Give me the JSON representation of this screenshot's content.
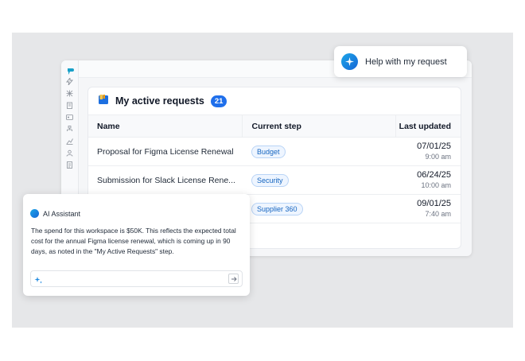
{
  "colors": {
    "accent": "#1f6feb",
    "pill_bg": "#eef5ff",
    "pill_text": "#1565c0",
    "backdrop": "#e6e7e9"
  },
  "sidebar": {
    "icons": [
      "app-logo-icon",
      "lightning-icon",
      "grid-icon",
      "building-icon",
      "id-card-icon",
      "hierarchy-icon",
      "chart-icon",
      "user-icon",
      "document-icon"
    ]
  },
  "help": {
    "label": "Help with my request",
    "icon": "sparkle-icon"
  },
  "requests": {
    "title": "My active requests",
    "count": "21",
    "columns": {
      "name": "Name",
      "step": "Current step",
      "updated": "Last updated"
    },
    "rows": [
      {
        "name": "Proposal for Figma License Renewal",
        "step": "Budget",
        "date": "07/01/25",
        "time": "9:00 am"
      },
      {
        "name": "Submission for Slack License Rene...",
        "step": "Security",
        "date": "06/24/25",
        "time": "10:00 am"
      },
      {
        "name": "",
        "step": "Supplier 360",
        "date": "09/01/25",
        "time": "7:40 am"
      }
    ]
  },
  "assistant": {
    "title": "AI Assistant",
    "message": "The spend for this workspace is $50K. This reflects the expected total cost for the annual Figma license renewal, which is coming up in 90 days, as noted in the \"My Active Requests\" step.",
    "input_placeholder": ""
  }
}
